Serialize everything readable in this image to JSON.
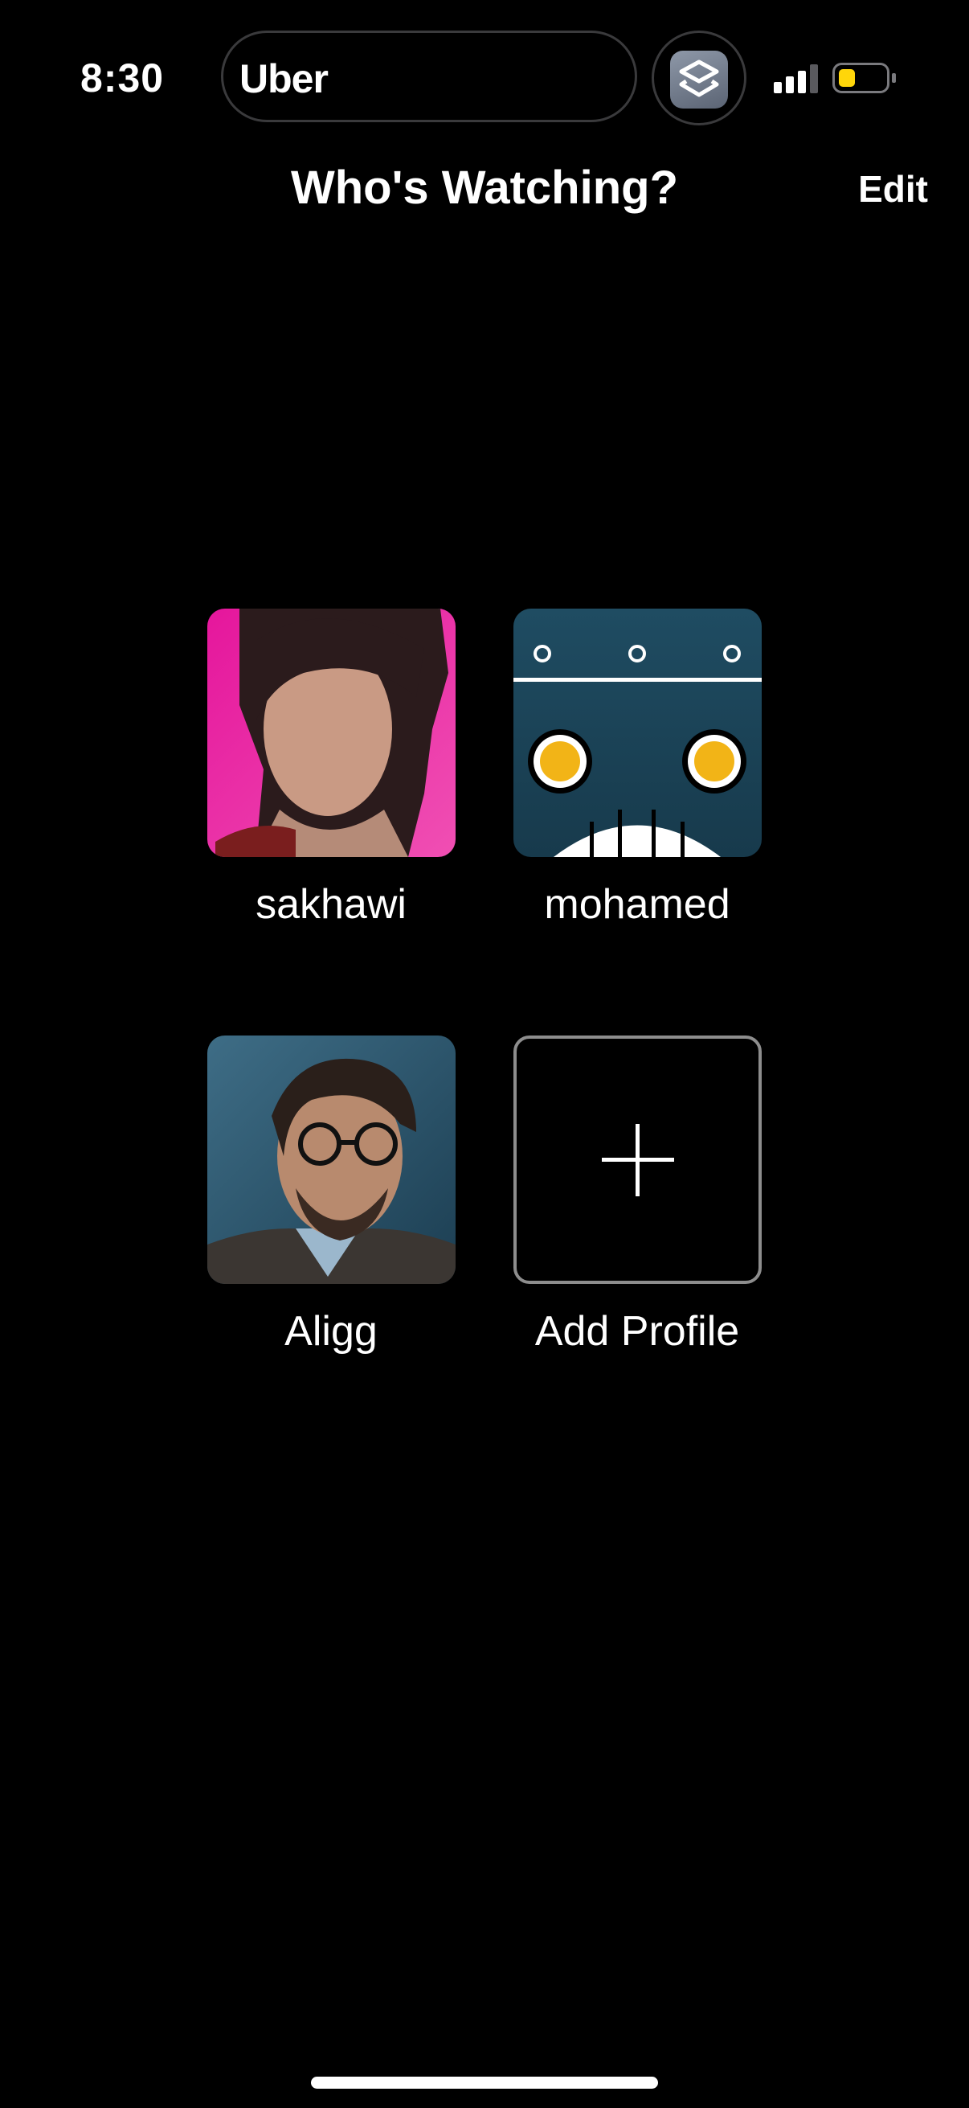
{
  "status_bar": {
    "time": "8:30",
    "island_app": "Uber",
    "island_icon": "shortcuts-app-icon",
    "battery_color": "#ffd60a"
  },
  "header": {
    "title": "Who's Watching?",
    "edit_label": "Edit"
  },
  "profiles": [
    {
      "name": "sakhawi",
      "avatar": "woman-portrait-avatar",
      "color": "#e5169c"
    },
    {
      "name": "mohamed",
      "avatar": "robot-face-avatar",
      "color": "#1f4c62"
    },
    {
      "name": "Aligg",
      "avatar": "man-glasses-portrait-avatar",
      "color": "#2f5a73"
    }
  ],
  "add_profile": {
    "label": "Add Profile",
    "icon": "plus-icon"
  }
}
